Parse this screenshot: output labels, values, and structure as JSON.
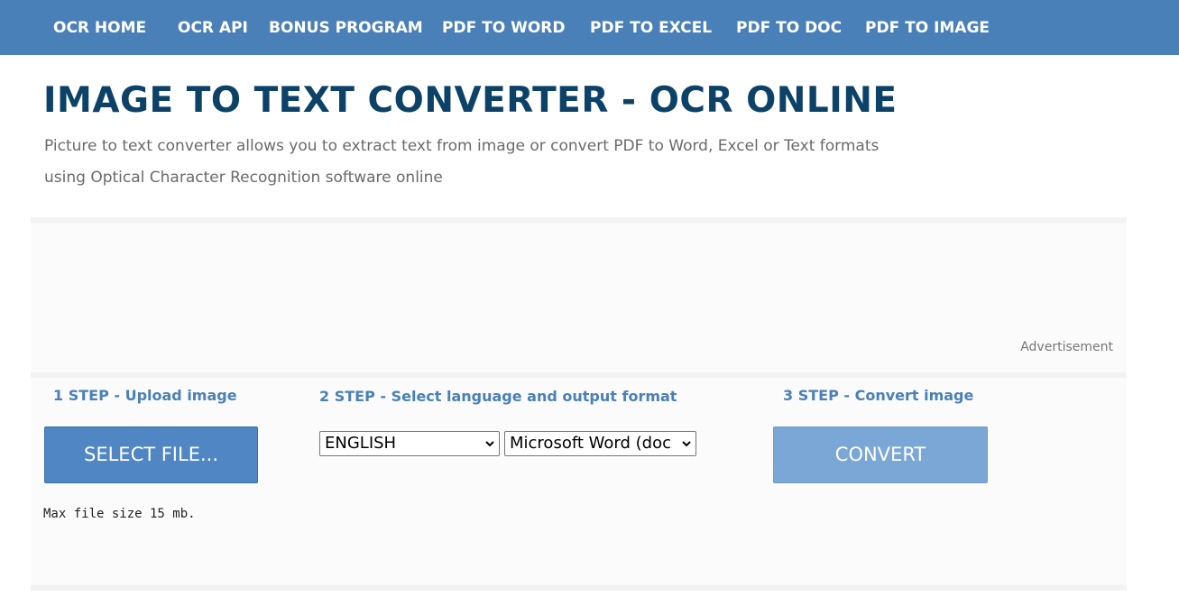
{
  "nav": {
    "items": [
      {
        "label": "OCR HOME"
      },
      {
        "label": "OCR API"
      },
      {
        "label": "BONUS PROGRAM"
      },
      {
        "label": "PDF TO WORD"
      },
      {
        "label": "PDF TO EXCEL"
      },
      {
        "label": "PDF TO DOC"
      },
      {
        "label": "PDF TO IMAGE"
      }
    ]
  },
  "header": {
    "title": "IMAGE TO TEXT CONVERTER - OCR ONLINE",
    "subtitle_line1": "Picture to text converter allows you to extract text from image or convert PDF to Word, Excel or Text formats",
    "subtitle_line2": "using Optical Character Recognition software online"
  },
  "ad": {
    "label": "Advertisement"
  },
  "steps": {
    "step1": {
      "heading": "1 STEP - Upload image",
      "button_label": "SELECT FILE...",
      "note": "Max file size 15 mb."
    },
    "step2": {
      "heading": "2 STEP - Select language and output format",
      "language_selected": "ENGLISH",
      "format_selected": "Microsoft Word (docx)"
    },
    "step3": {
      "heading": "3 STEP - Convert image",
      "button_label": "CONVERT"
    }
  },
  "colors": {
    "nav_background": "#4a80b8",
    "title": "#0d4268",
    "step_heading": "#4a80b8",
    "select_button": "#4f86c3",
    "convert_button": "#7ba7d6"
  }
}
